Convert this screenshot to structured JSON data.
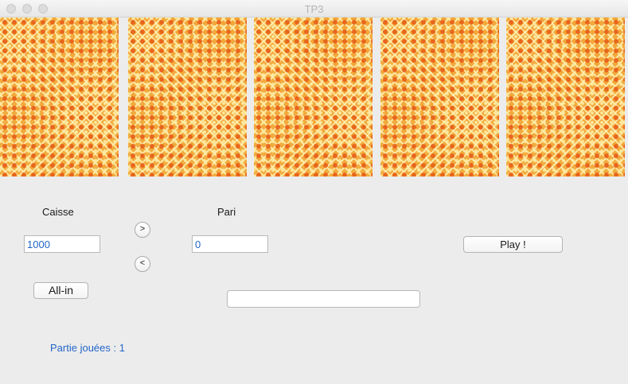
{
  "window": {
    "title": "TP3"
  },
  "cards": [
    {
      "label": "card-back-1"
    },
    {
      "label": "card-back-2"
    },
    {
      "label": "card-back-3"
    },
    {
      "label": "card-back-4"
    },
    {
      "label": "card-back-5"
    }
  ],
  "caisse": {
    "label": "Caisse",
    "value": "1000"
  },
  "pari": {
    "label": "Pari",
    "value": "0"
  },
  "controls": {
    "increase_label": ">",
    "decrease_label": "<",
    "play_label": "Play !",
    "allin_label": "All-in"
  },
  "message": {
    "value": ""
  },
  "status": {
    "games_played": "Partie jouées : 1"
  },
  "colors": {
    "accent_text": "#2466c8",
    "card_base": "#f4b63c",
    "card_flower": "#e8661c",
    "background": "#ececec"
  }
}
